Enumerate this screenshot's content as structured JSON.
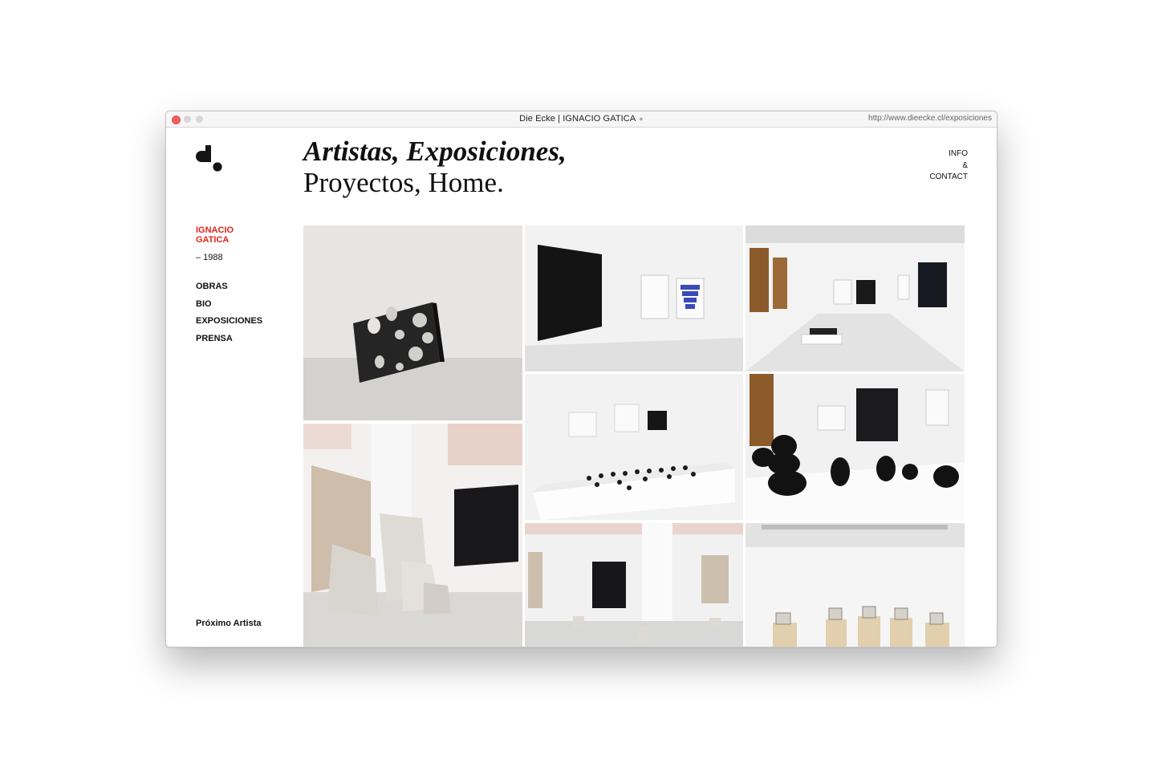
{
  "browser": {
    "title": "Die Ecke | IGNACIO GATICA",
    "url": "http://www.dieecke.cl/exposiciones"
  },
  "header": {
    "title_italic": "Artistas, Exposiciones,",
    "title_roman": "Proyectos, Home.",
    "info_nav": [
      "INFO",
      "&",
      "CONTACT"
    ]
  },
  "artist": {
    "name": "IGNACIO GATICA",
    "year": "– 1988"
  },
  "sidebar": {
    "items": [
      {
        "label": "OBRAS"
      },
      {
        "label": "BIO"
      },
      {
        "label": "EXPOSICIONES"
      },
      {
        "label": "PRENSA"
      }
    ],
    "next_label": "Próximo Artista"
  },
  "colors": {
    "accent": "#e1241c",
    "text": "#111111"
  },
  "gallery": {
    "photo_count": 8
  }
}
